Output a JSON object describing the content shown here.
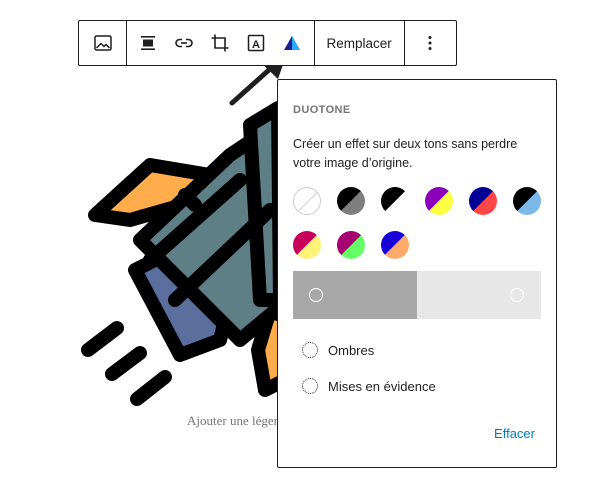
{
  "toolbar": {
    "replace_label": "Remplacer",
    "icons": [
      "image-icon",
      "align-icon",
      "link-icon",
      "crop-icon",
      "text-overlay-icon",
      "duotone-icon",
      "more-options-icon"
    ]
  },
  "caption": {
    "placeholder": "Ajouter une légende"
  },
  "duotone": {
    "title": "DUOTONE",
    "description": "Créer un effet sur deux tons sans perdre votre image d’origine.",
    "presets": [
      {
        "name": "none",
        "colors": []
      },
      {
        "name": "black-grey",
        "colors": [
          "#000000",
          "#7f7f7f"
        ]
      },
      {
        "name": "black-white",
        "colors": [
          "#000000",
          "#ffffff"
        ]
      },
      {
        "name": "purple-yellow",
        "colors": [
          "#8c00b7",
          "#fcff41"
        ]
      },
      {
        "name": "blue-red",
        "colors": [
          "#000097",
          "#ff4747"
        ]
      },
      {
        "name": "black-blue",
        "colors": [
          "#000000",
          "#7db9e8"
        ]
      },
      {
        "name": "magenta-yellow",
        "colors": [
          "#c7005a",
          "#fff278"
        ]
      },
      {
        "name": "magenta-green",
        "colors": [
          "#a60072",
          "#67ff66"
        ]
      },
      {
        "name": "blue-orange",
        "colors": [
          "#1900d8",
          "#ffa96b"
        ]
      }
    ],
    "slider": {
      "shadow_color": "#a8a8a8",
      "highlight_color": "#e7e7e7",
      "split": 0.5
    },
    "options": {
      "shadows_label": "Ombres",
      "highlights_label": "Mises en évidence"
    },
    "clear_label": "Effacer"
  },
  "colors": {
    "accent": "#007cba",
    "rocket_body": "#5f7f87",
    "rocket_flame": "#ffad4c",
    "rocket_panel": "#5a6f9e"
  }
}
